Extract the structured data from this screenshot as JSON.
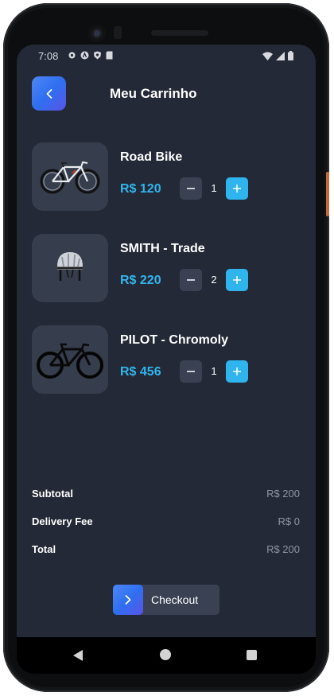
{
  "status_bar": {
    "time": "7:08",
    "left_icons": [
      "gear-icon",
      "a-icon",
      "shield-icon",
      "sd-card-icon"
    ],
    "right_icons": [
      "wifi-icon",
      "signal-icon",
      "battery-icon"
    ]
  },
  "header": {
    "title": "Meu Carrinho",
    "back_icon": "chevron-left-icon"
  },
  "cart": {
    "items": [
      {
        "name": "Road Bike",
        "price": "R$ 120",
        "quantity": "1",
        "image": "road-bike"
      },
      {
        "name": "SMITH - Trade",
        "price": "R$ 220",
        "quantity": "2",
        "image": "helmet"
      },
      {
        "name": "PILOT - Chromoly",
        "price": "R$ 456",
        "quantity": "1",
        "image": "black-bike"
      }
    ]
  },
  "summary": {
    "subtotal_label": "Subtotal",
    "subtotal_value": "R$ 200",
    "delivery_label": "Delivery Fee",
    "delivery_value": "R$ 0",
    "total_label": "Total",
    "total_value": "R$ 200"
  },
  "checkout": {
    "label": "Checkout",
    "icon": "chevron-right-icon"
  },
  "navbar": {
    "icons": [
      "nav-back-icon",
      "nav-home-icon",
      "nav-recents-icon"
    ]
  },
  "colors": {
    "background": "#232936",
    "card": "#363d4c",
    "accent": "#2fb4ee",
    "gradient_start": "#4f86f7",
    "gradient_end": "#5a55e8"
  }
}
